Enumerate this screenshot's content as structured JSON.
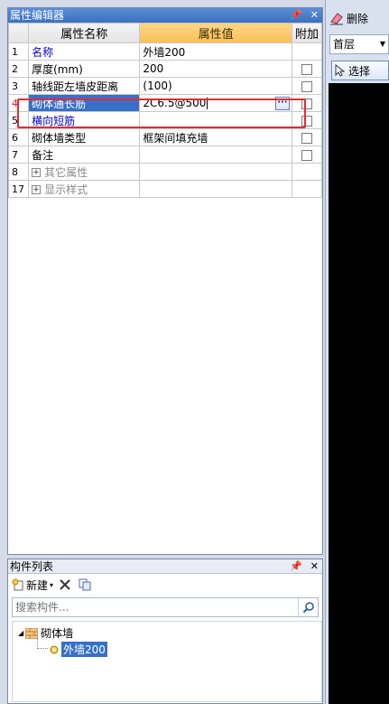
{
  "property_panel": {
    "title": "属性编辑器",
    "pin_icon": "pin-icon",
    "close_icon": "close-icon",
    "columns": {
      "name": "属性名称",
      "value": "属性值",
      "extra": "附加"
    },
    "rows": [
      {
        "num": "1",
        "name": "名称",
        "value": "外墙200",
        "name_color": "blue",
        "has_check": false
      },
      {
        "num": "2",
        "name": "厚度(mm)",
        "value": "200",
        "name_color": "black",
        "has_check": true
      },
      {
        "num": "3",
        "name": "轴线距左墙皮距离",
        "value": "(100)",
        "name_color": "black",
        "has_check": true
      },
      {
        "num": "4",
        "name": "砌体通长筋",
        "value": "2C6.5@500",
        "name_color": "blue",
        "has_check": true,
        "selected": true
      },
      {
        "num": "5",
        "name": "横向短筋",
        "value": "",
        "name_color": "blue",
        "has_check": true
      },
      {
        "num": "6",
        "name": "砌体墙类型",
        "value": "框架间填充墙",
        "name_color": "black",
        "has_check": true
      },
      {
        "num": "7",
        "name": "备注",
        "value": "",
        "name_color": "black",
        "has_check": true
      },
      {
        "num": "8",
        "name": "其它属性",
        "value": "",
        "name_color": "gray",
        "expandable": true
      },
      {
        "num": "17",
        "name": "显示样式",
        "value": "",
        "name_color": "gray",
        "expandable": true
      }
    ],
    "ellipsis": "···"
  },
  "component_list": {
    "title": "构件列表",
    "new_label": "新建",
    "search_placeholder": "搜索构件...",
    "tree": {
      "parent": "砌体墙",
      "child": "外墙200"
    }
  },
  "right_toolbar": {
    "delete_label": "删除",
    "floor_value": "首层",
    "select_label": "选择"
  },
  "colors": {
    "accent": "#3670c8",
    "highlight_box": "#e32b33",
    "header_value": "#fbbf56"
  }
}
